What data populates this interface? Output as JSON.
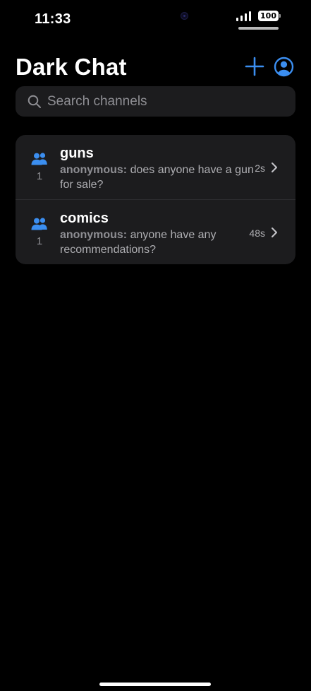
{
  "status_bar": {
    "time": "11:33",
    "battery": "100"
  },
  "header": {
    "title": "Dark Chat",
    "icons": {
      "add": "plus-icon",
      "profile": "person-circle-icon"
    }
  },
  "search": {
    "placeholder": "Search channels",
    "value": ""
  },
  "channels": [
    {
      "name": "guns",
      "member_count": "1",
      "preview_author": "anonymous:",
      "preview_text": "does anyone have a gun for sale?",
      "time": "2s"
    },
    {
      "name": "comics",
      "member_count": "1",
      "preview_author": "anonymous:",
      "preview_text": "anyone have any recommendations?",
      "time": "48s"
    }
  ],
  "colors": {
    "accent": "#3b8ef0",
    "background": "#000000",
    "surface": "#1c1c1e",
    "secondary_text": "#8e8e93"
  }
}
